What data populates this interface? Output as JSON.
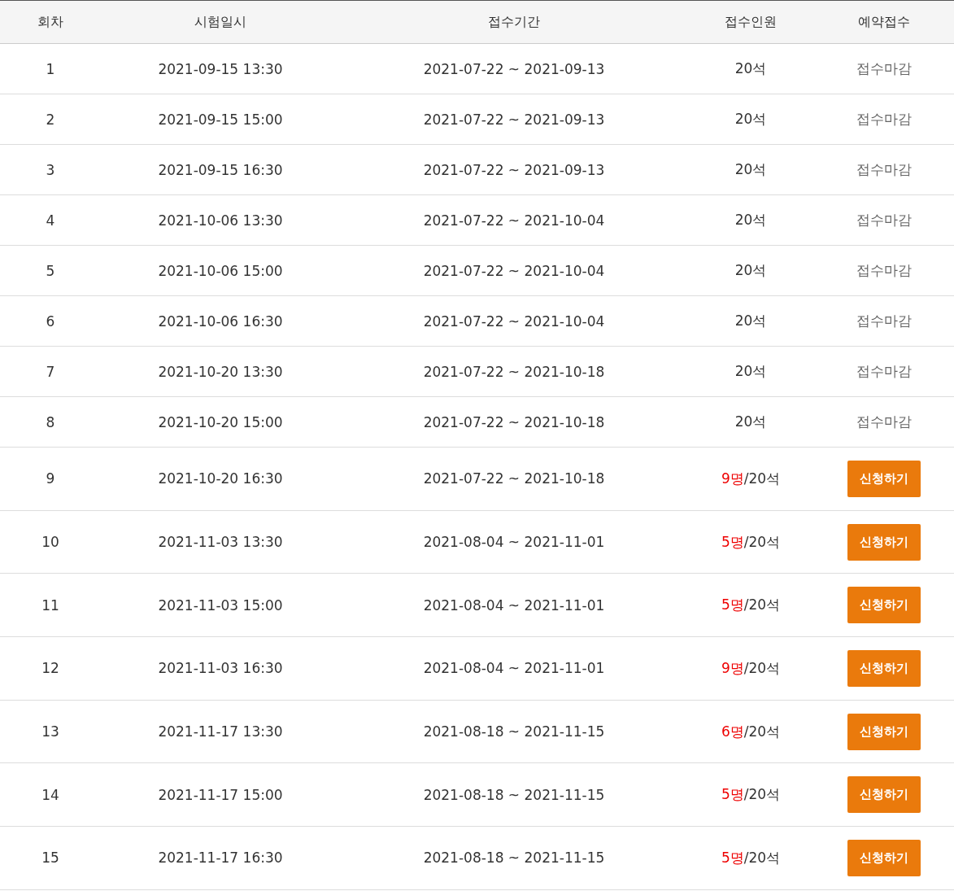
{
  "table": {
    "columns": [
      "회차",
      "시험일시",
      "접수기간",
      "접수인원",
      "예약접수"
    ],
    "rows": [
      {
        "round": "1",
        "exam_date": "2021-09-15 13:30",
        "period": "2021-07-22 ~ 2021-09-13",
        "applied": "",
        "capacity": "20석",
        "reservation": {
          "kind": "closed",
          "label": "접수마감"
        }
      },
      {
        "round": "2",
        "exam_date": "2021-09-15 15:00",
        "period": "2021-07-22 ~ 2021-09-13",
        "applied": "",
        "capacity": "20석",
        "reservation": {
          "kind": "closed",
          "label": "접수마감"
        }
      },
      {
        "round": "3",
        "exam_date": "2021-09-15 16:30",
        "period": "2021-07-22 ~ 2021-09-13",
        "applied": "",
        "capacity": "20석",
        "reservation": {
          "kind": "closed",
          "label": "접수마감"
        }
      },
      {
        "round": "4",
        "exam_date": "2021-10-06 13:30",
        "period": "2021-07-22 ~ 2021-10-04",
        "applied": "",
        "capacity": "20석",
        "reservation": {
          "kind": "closed",
          "label": "접수마감"
        }
      },
      {
        "round": "5",
        "exam_date": "2021-10-06 15:00",
        "period": "2021-07-22 ~ 2021-10-04",
        "applied": "",
        "capacity": "20석",
        "reservation": {
          "kind": "closed",
          "label": "접수마감"
        }
      },
      {
        "round": "6",
        "exam_date": "2021-10-06 16:30",
        "period": "2021-07-22 ~ 2021-10-04",
        "applied": "",
        "capacity": "20석",
        "reservation": {
          "kind": "closed",
          "label": "접수마감"
        }
      },
      {
        "round": "7",
        "exam_date": "2021-10-20 13:30",
        "period": "2021-07-22 ~ 2021-10-18",
        "applied": "",
        "capacity": "20석",
        "reservation": {
          "kind": "closed",
          "label": "접수마감"
        }
      },
      {
        "round": "8",
        "exam_date": "2021-10-20 15:00",
        "period": "2021-07-22 ~ 2021-10-18",
        "applied": "",
        "capacity": "20석",
        "reservation": {
          "kind": "closed",
          "label": "접수마감"
        }
      },
      {
        "round": "9",
        "exam_date": "2021-10-20 16:30",
        "period": "2021-07-22 ~ 2021-10-18",
        "applied": "9명",
        "capacity": "/20석",
        "reservation": {
          "kind": "button",
          "label": "신청하기"
        }
      },
      {
        "round": "10",
        "exam_date": "2021-11-03 13:30",
        "period": "2021-08-04 ~ 2021-11-01",
        "applied": "5명",
        "capacity": "/20석",
        "reservation": {
          "kind": "button",
          "label": "신청하기"
        }
      },
      {
        "round": "11",
        "exam_date": "2021-11-03 15:00",
        "period": "2021-08-04 ~ 2021-11-01",
        "applied": "5명",
        "capacity": "/20석",
        "reservation": {
          "kind": "button",
          "label": "신청하기"
        }
      },
      {
        "round": "12",
        "exam_date": "2021-11-03 16:30",
        "period": "2021-08-04 ~ 2021-11-01",
        "applied": "9명",
        "capacity": "/20석",
        "reservation": {
          "kind": "button",
          "label": "신청하기"
        }
      },
      {
        "round": "13",
        "exam_date": "2021-11-17 13:30",
        "period": "2021-08-18 ~ 2021-11-15",
        "applied": "6명",
        "capacity": "/20석",
        "reservation": {
          "kind": "button",
          "label": "신청하기"
        }
      },
      {
        "round": "14",
        "exam_date": "2021-11-17 15:00",
        "period": "2021-08-18 ~ 2021-11-15",
        "applied": "5명",
        "capacity": "/20석",
        "reservation": {
          "kind": "button",
          "label": "신청하기"
        }
      },
      {
        "round": "15",
        "exam_date": "2021-11-17 16:30",
        "period": "2021-08-18 ~ 2021-11-15",
        "applied": "5명",
        "capacity": "/20석",
        "reservation": {
          "kind": "button",
          "label": "신청하기"
        }
      }
    ]
  }
}
